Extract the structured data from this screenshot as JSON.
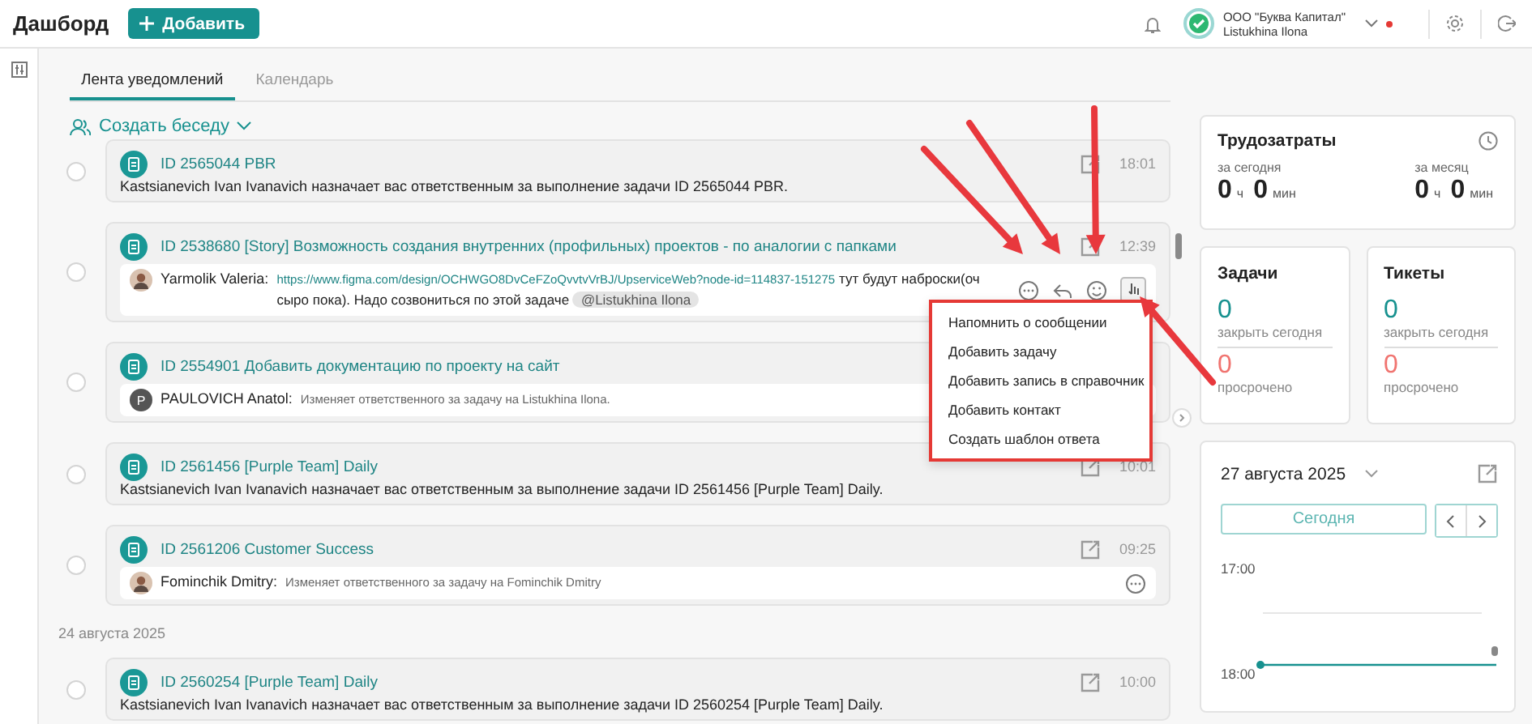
{
  "header": {
    "title": "Дашборд",
    "add_button": "Добавить",
    "company": "ООО \"Буква Капитал\"",
    "user": "Listukhina Ilona"
  },
  "tabs": [
    {
      "label": "Лента уведомлений",
      "selected": true
    },
    {
      "label": "Календарь",
      "selected": false
    }
  ],
  "create_chat": "Создать беседу",
  "feed": [
    {
      "kind": "card",
      "title": "ID 2565044 PBR",
      "time": "18:01",
      "edit_icon": true,
      "checked": false,
      "body": {
        "kind": "text",
        "text": "Kastsianevich Ivan Ivanavich назначает вас ответственным за выполнение задачи ID 2565044 PBR."
      }
    },
    {
      "kind": "card",
      "title": "ID 2538680 [Story] Возможность создания внутренних (профильных) проектов - по аналогии с папками",
      "time": "12:39",
      "edit_icon": true,
      "checked": false,
      "body": {
        "kind": "comment",
        "photo_avatar": true,
        "author": "Yarmolik Valeria:",
        "link": "https://www.figma.com/design/OCHWGO8DvCeFZoQvvtvVrBJ/UpserviceWeb?node-id=114837-151275",
        "text": "тут будут наброски(оч сыро пока). Надо созвониться по этой задаче",
        "mention": "@Listukhina Ilona",
        "hover_actions": true
      }
    },
    {
      "kind": "card",
      "title": "ID 2554901 Добавить документацию по проекту на сайт",
      "edit_icon": false,
      "checked": false,
      "body": {
        "kind": "comment",
        "photo_avatar": false,
        "initial": "P",
        "author": "PAULOVICH Anatol:",
        "text": "Изменяет ответственного за задачу на Listukhina Ilona."
      }
    },
    {
      "kind": "card",
      "title": "ID 2561456 [Purple Team] Daily",
      "time": "10:01",
      "edit_icon": true,
      "checked": false,
      "body": {
        "kind": "text",
        "text": "Kastsianevich Ivan Ivanavich назначает вас ответственным за выполнение задачи ID 2561456 [Purple Team] Daily."
      }
    },
    {
      "kind": "card",
      "title": "ID 2561206 Customer Success",
      "time": "09:25",
      "edit_icon": true,
      "checked": false,
      "body": {
        "kind": "comment",
        "photo_avatar": true,
        "author": "Fominchik Dmitry:",
        "text": "Изменяет ответственного за задачу на Fominchik Dmitry",
        "comment_icon": true
      }
    },
    {
      "kind": "date",
      "label": "24 августа 2025"
    },
    {
      "kind": "card",
      "title": "ID 2560254 [Purple Team] Daily",
      "time": "10:00",
      "edit_icon": true,
      "checked": false,
      "body": {
        "kind": "text",
        "text": "Kastsianevich Ivan Ivanavich назначает вас ответственным за выполнение задачи ID 2560254 [Purple Team] Daily."
      }
    }
  ],
  "work": {
    "title": "Трудозатраты",
    "periods": [
      {
        "label": "за сегодня",
        "hours": "0",
        "hours_unit": "ч",
        "minutes": "0",
        "minutes_unit": "мин"
      },
      {
        "label": "за месяц",
        "hours": "0",
        "hours_unit": "ч",
        "minutes": "0",
        "minutes_unit": "мин"
      }
    ]
  },
  "counters": [
    {
      "title": "Задачи",
      "open": "0",
      "open_label": "закрыть сегодня",
      "overdue": "0",
      "overdue_label": "просрочено"
    },
    {
      "title": "Тикеты",
      "open": "0",
      "open_label": "закрыть сегодня",
      "overdue": "0",
      "overdue_label": "просрочено"
    }
  ],
  "calendar": {
    "date": "27 августа 2025",
    "today_button": "Сегодня",
    "hours": [
      "17:00",
      "18:00"
    ]
  },
  "context_menu": {
    "highlighted": true,
    "items": [
      "Напомнить о сообщении",
      "Добавить задачу",
      "Добавить запись в справочник",
      "Добавить контакт",
      "Создать шаблон ответа"
    ]
  },
  "annotations": [
    {
      "kind": "arrow"
    },
    {
      "kind": "arrow"
    },
    {
      "kind": "arrow"
    },
    {
      "kind": "arrow"
    }
  ]
}
